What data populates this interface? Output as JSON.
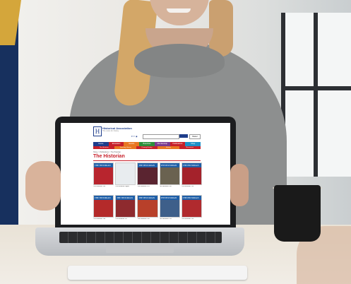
{
  "site": {
    "logo_letter": "H",
    "org_name": "Historical Association",
    "tagline": "The voice for history",
    "social_icons": "♥ ✦ ◉",
    "basket_label": "Basket",
    "nav_items": [
      "Home",
      "Education",
      "Events",
      "Branches",
      "Membership",
      "Publications",
      "Shop"
    ],
    "nav_colors": [
      "#1e3d8b",
      "#c7202a",
      "#e87722",
      "#2c8f3b",
      "#7a3b8f",
      "#c7202a",
      "#1e90c8"
    ],
    "subnav_items": [
      "The Historian",
      "Teaching History",
      "Primary History",
      "History",
      "Resources"
    ],
    "breadcrumb": "Home > Publications > The Historian",
    "page_title": "The Historian",
    "magazines": [
      {
        "masthead": "THE HISTORIAN",
        "caption": "The Historian 143",
        "color": "#b8252e"
      },
      {
        "masthead": "",
        "caption": "The Historian Digital",
        "color": "#e8ecef"
      },
      {
        "masthead": "THE HISTORIAN",
        "caption": "The Historian 141",
        "color": "#5a2430"
      },
      {
        "masthead": "THE HISTORIAN",
        "caption": "The Historian 140",
        "color": "#6a6250"
      },
      {
        "masthead": "THE HISTORIAN",
        "caption": "The Historian 139",
        "color": "#a4222b"
      },
      {
        "masthead": "THE HISTORIAN",
        "caption": "The Historian 138",
        "color": "#b42a2a"
      },
      {
        "masthead": "THE HISTORIAN",
        "caption": "The Historian 137",
        "color": "#8e2a2e"
      },
      {
        "masthead": "THE HISTORIAN",
        "caption": "The Historian 136",
        "color": "#b8402a"
      },
      {
        "masthead": "THE HISTORIAN",
        "caption": "The Historian 135",
        "color": "#3e5f8a"
      },
      {
        "masthead": "THE HISTORIAN",
        "caption": "The Historian 134",
        "color": "#b02a2e"
      }
    ]
  }
}
